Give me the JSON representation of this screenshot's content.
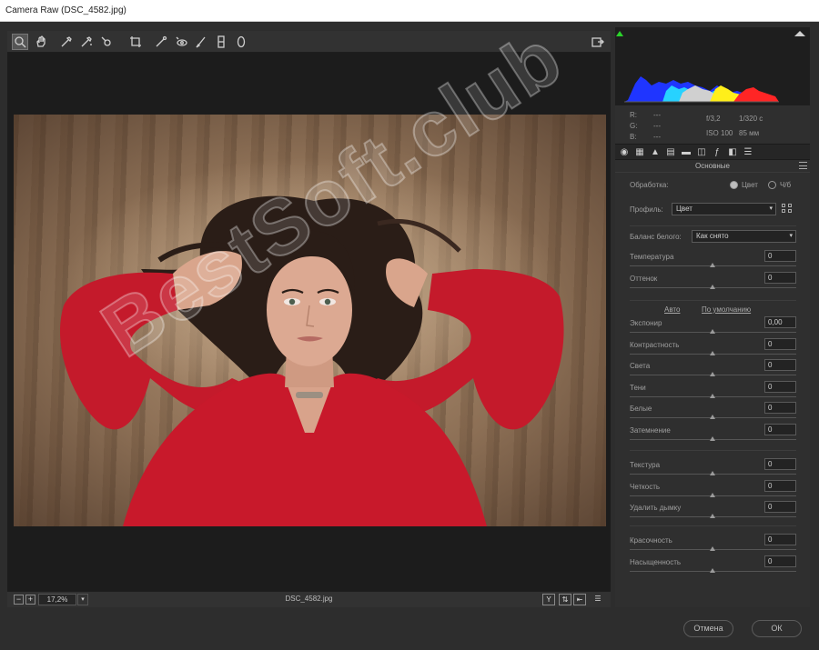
{
  "window": {
    "title": "Camera Raw (DSC_4582.jpg)"
  },
  "toolbar": {
    "tools": [
      "zoom-icon",
      "hand-icon",
      "white-balance-icon",
      "color-sampler-icon",
      "target-adjustment-icon",
      "crop-icon",
      "spot-removal-icon",
      "red-eye-icon",
      "brush-icon",
      "graduated-filter-icon",
      "radial-filter-icon"
    ],
    "export_icon": "open-preferences-icon"
  },
  "statusbar": {
    "zoom_out": "−",
    "zoom_in": "+",
    "zoom": "17,2%",
    "filename": "DSC_4582.jpg",
    "btn_y": "Y",
    "btn_compare": "⇅",
    "btn_swap": "⇤",
    "btn_settings": "☰"
  },
  "metadata": {
    "r_label": "R:",
    "r_val": "---",
    "g_label": "G:",
    "g_val": "---",
    "b_label": "B:",
    "b_val": "---",
    "aperture": "f/3,2",
    "shutter": "1/320 с",
    "iso": "ISO 100",
    "focal": "85 мм"
  },
  "panel": {
    "section_title": "Основные",
    "treatment_label": "Обработка:",
    "treatment_color": "Цвет",
    "treatment_bw": "Ч/б",
    "profile_label": "Профиль:",
    "profile_value": "Цвет",
    "wb_label": "Баланс белого:",
    "wb_value": "Как снято",
    "auto_link": "Авто",
    "default_link": "По умолчанию",
    "sliders_top": [
      {
        "name": "Температура",
        "value": "0"
      },
      {
        "name": "Оттенок",
        "value": "0"
      }
    ],
    "sliders_tone": [
      {
        "name": "Экспонир",
        "value": "0,00"
      },
      {
        "name": "Контрастность",
        "value": "0"
      },
      {
        "name": "Света",
        "value": "0"
      },
      {
        "name": "Тени",
        "value": "0"
      },
      {
        "name": "Белые",
        "value": "0"
      },
      {
        "name": "Затемнение",
        "value": "0"
      }
    ],
    "sliders_presence": [
      {
        "name": "Текстура",
        "value": "0"
      },
      {
        "name": "Четкость",
        "value": "0"
      },
      {
        "name": "Удалить дымку",
        "value": "0"
      }
    ],
    "sliders_color": [
      {
        "name": "Красочность",
        "value": "0"
      },
      {
        "name": "Насыщенность",
        "value": "0"
      }
    ]
  },
  "buttons": {
    "cancel": "Отмена",
    "ok": "ОК"
  },
  "watermark": "BestSoft.club"
}
